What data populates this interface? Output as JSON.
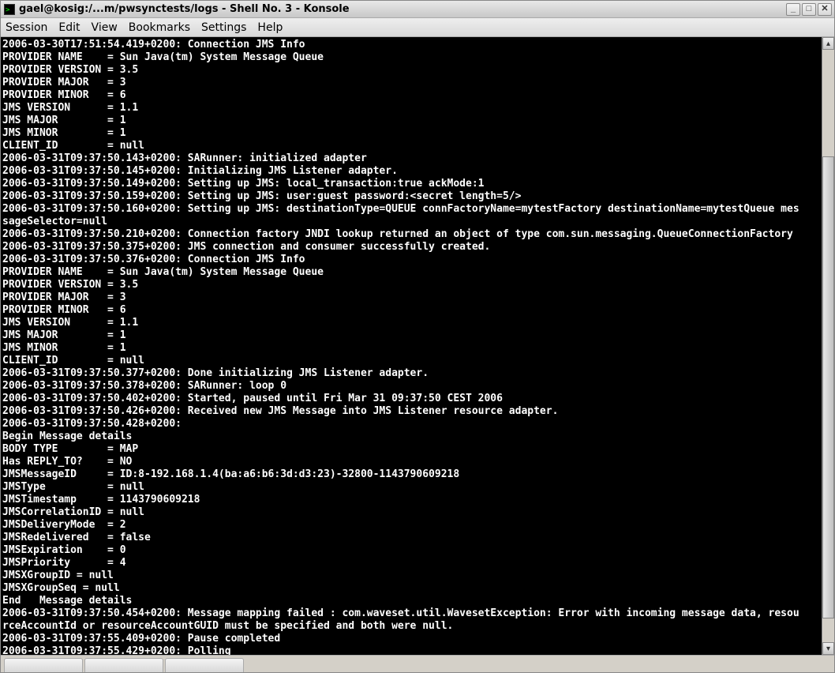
{
  "window": {
    "title": "gael@kosig:/...m/pwsynctests/logs - Shell No. 3 - Konsole",
    "icon_name": "terminal-icon"
  },
  "window_controls": {
    "minimize_glyph": "_",
    "maximize_glyph": "□",
    "close_glyph": "✕"
  },
  "menu": {
    "items": [
      "Session",
      "Edit",
      "View",
      "Bookmarks",
      "Settings",
      "Help"
    ]
  },
  "scrollbar": {
    "up_arrow": "▴",
    "down_arrow": "▾"
  },
  "terminal": {
    "lines": [
      "2006-03-30T17:51:54.419+0200: Connection JMS Info",
      "PROVIDER NAME    = Sun Java(tm) System Message Queue",
      "PROVIDER VERSION = 3.5",
      "PROVIDER MAJOR   = 3",
      "PROVIDER MINOR   = 6",
      "JMS VERSION      = 1.1",
      "JMS MAJOR        = 1",
      "JMS MINOR        = 1",
      "CLIENT_ID        = null",
      "2006-03-31T09:37:50.143+0200: SARunner: initialized adapter",
      "2006-03-31T09:37:50.145+0200: Initializing JMS Listener adapter.",
      "2006-03-31T09:37:50.149+0200: Setting up JMS: local_transaction:true ackMode:1",
      "2006-03-31T09:37:50.159+0200: Setting up JMS: user:guest password:<secret length=5/>",
      "2006-03-31T09:37:50.160+0200: Setting up JMS: destinationType=QUEUE connFactoryName=mytestFactory destinationName=mytestQueue mes",
      "sageSelector=null",
      "2006-03-31T09:37:50.210+0200: Connection factory JNDI lookup returned an object of type com.sun.messaging.QueueConnectionFactory",
      "2006-03-31T09:37:50.375+0200: JMS connection and consumer successfully created.",
      "2006-03-31T09:37:50.376+0200: Connection JMS Info",
      "PROVIDER NAME    = Sun Java(tm) System Message Queue",
      "PROVIDER VERSION = 3.5",
      "PROVIDER MAJOR   = 3",
      "PROVIDER MINOR   = 6",
      "JMS VERSION      = 1.1",
      "JMS MAJOR        = 1",
      "JMS MINOR        = 1",
      "CLIENT_ID        = null",
      "2006-03-31T09:37:50.377+0200: Done initializing JMS Listener adapter.",
      "2006-03-31T09:37:50.378+0200: SARunner: loop 0",
      "2006-03-31T09:37:50.402+0200: Started, paused until Fri Mar 31 09:37:50 CEST 2006",
      "2006-03-31T09:37:50.426+0200: Received new JMS Message into JMS Listener resource adapter.",
      "2006-03-31T09:37:50.428+0200:",
      "Begin Message details",
      "BODY TYPE        = MAP",
      "Has REPLY_TO?    = NO",
      "JMSMessageID     = ID:8-192.168.1.4(ba:a6:b6:3d:d3:23)-32800-1143790609218",
      "JMSType          = null",
      "JMSTimestamp     = 1143790609218",
      "JMSCorrelationID = null",
      "JMSDeliveryMode  = 2",
      "JMSRedelivered   = false",
      "JMSExpiration    = 0",
      "JMSPriority      = 4",
      "JMSXGroupID = null",
      "JMSXGroupSeq = null",
      "End   Message details",
      "2006-03-31T09:37:50.454+0200: Message mapping failed : com.waveset.util.WavesetException: Error with incoming message data, resou",
      "rceAccountId or resourceAccountGUID must be specified and both were null.",
      "2006-03-31T09:37:55.409+0200: Pause completed",
      "2006-03-31T09:37:55.429+0200: Polling"
    ]
  }
}
